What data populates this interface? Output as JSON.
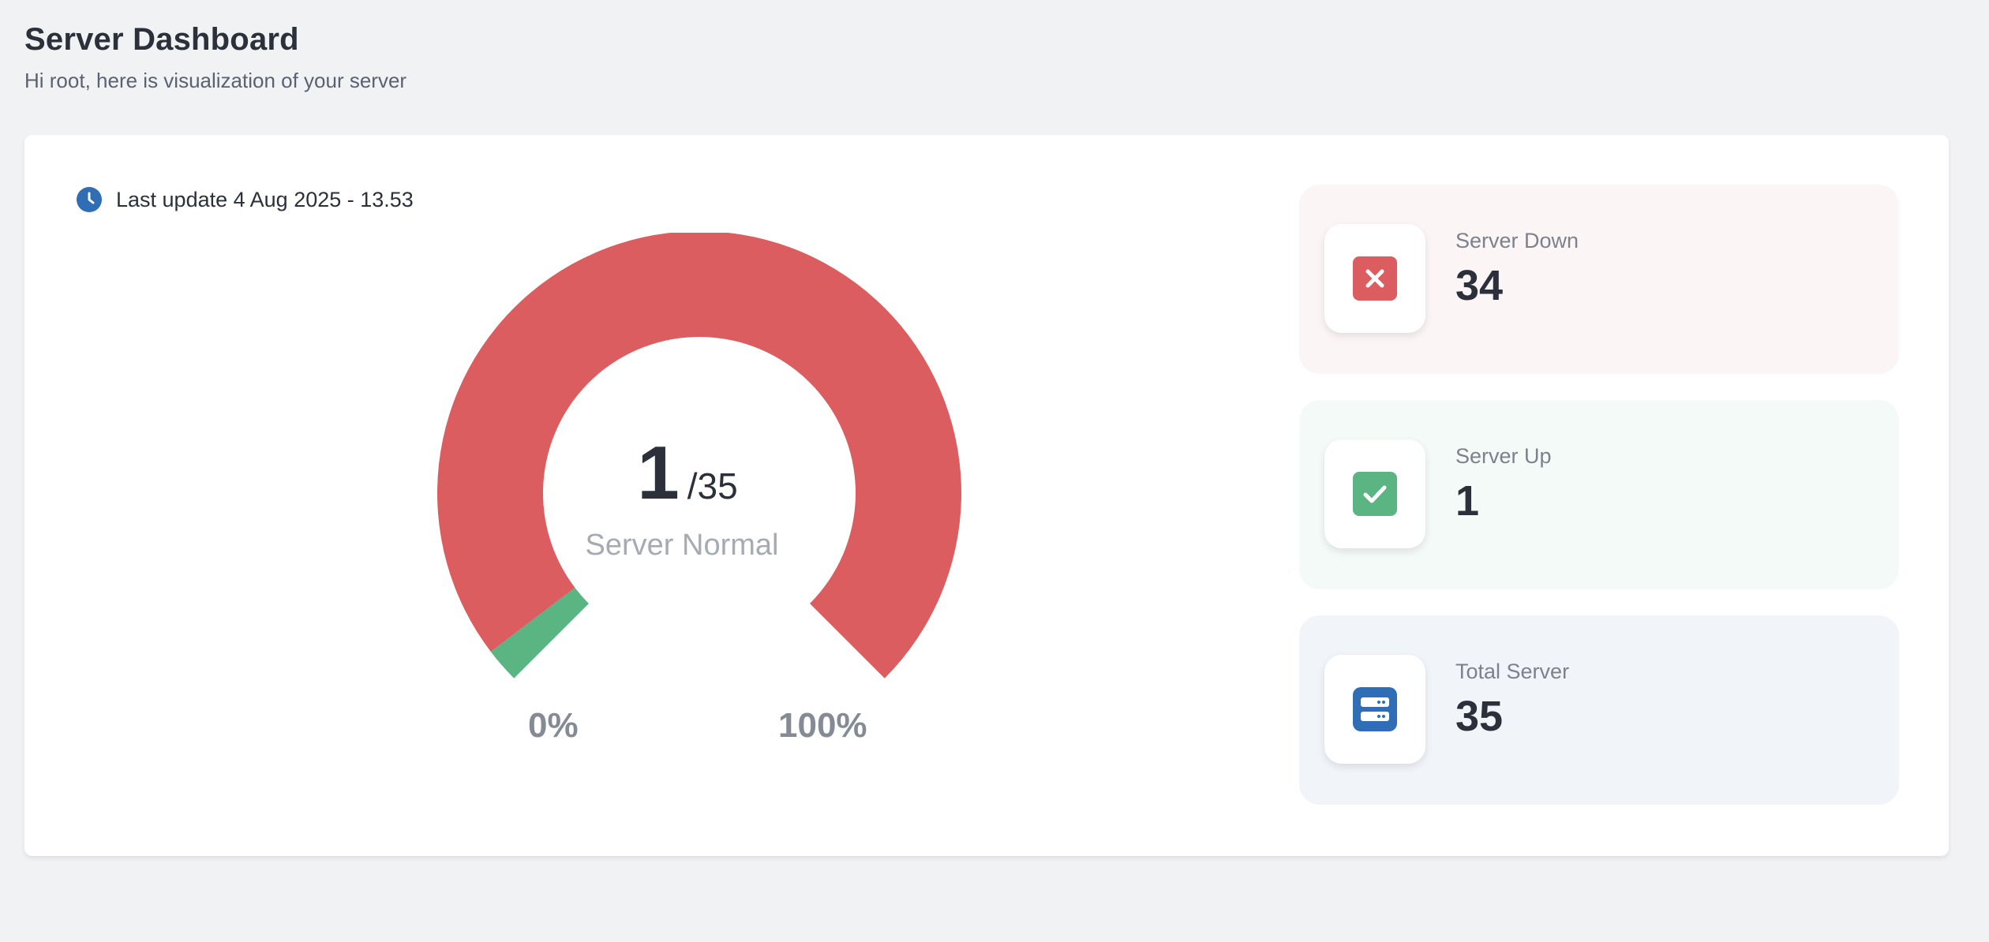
{
  "header": {
    "title": "Server Dashboard",
    "subtitle": "Hi root, here is visualization of your server"
  },
  "last_update": {
    "icon": "clock-icon",
    "text": "Last update 4 Aug 2025 - 13.53"
  },
  "gauge": {
    "value": "1",
    "total": "/35",
    "label": "Server Normal",
    "min_label": "0%",
    "max_label": "100%",
    "normal_count": 1,
    "total_count": 35,
    "colors": {
      "normal": "#5bb583",
      "down": "#dc5d5f"
    }
  },
  "stats": {
    "down": {
      "label": "Server Down",
      "value": "34",
      "icon": "x-square-icon",
      "color": "#dc5d5f"
    },
    "up": {
      "label": "Server Up",
      "value": "1",
      "icon": "check-square-icon",
      "color": "#5bb583"
    },
    "total": {
      "label": "Total Server",
      "value": "35",
      "icon": "server-icon",
      "color": "#2f6db5"
    }
  }
}
